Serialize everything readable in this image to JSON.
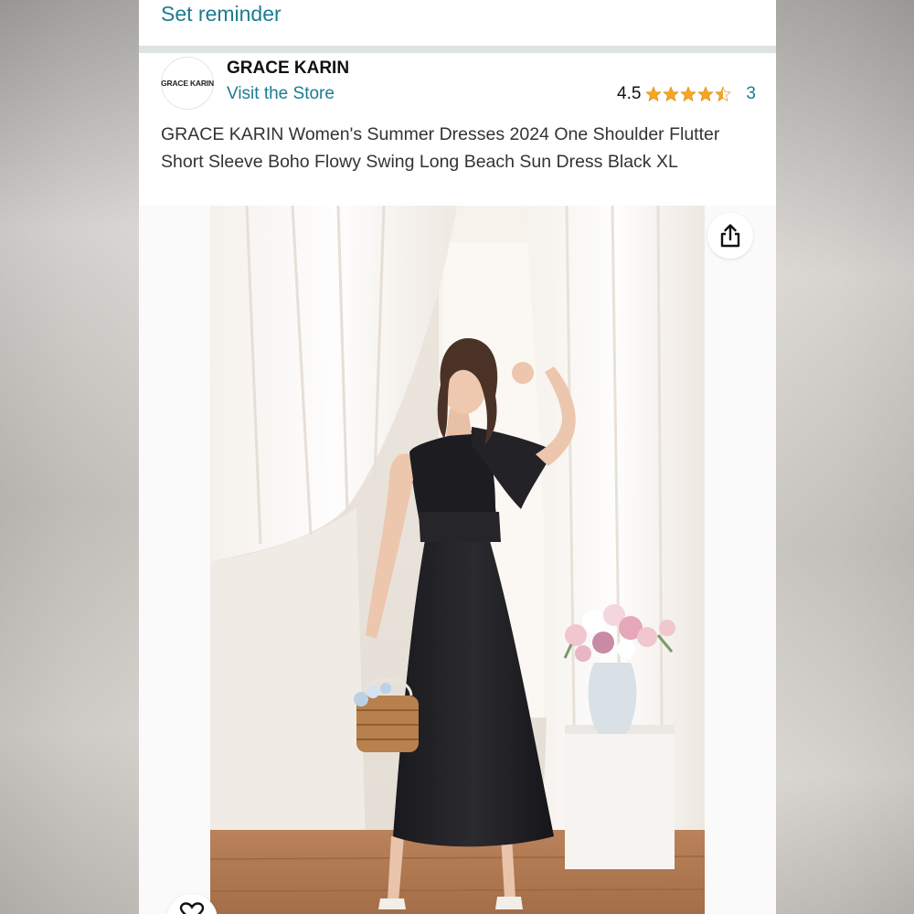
{
  "header": {
    "set_reminder": "Set reminder"
  },
  "store": {
    "logo_text": "GRACE KARIN",
    "brand_name": "GRACE KARIN",
    "visit_store": "Visit the Store",
    "rating": "4.5",
    "rating_stars": 4.5,
    "rating_count": "3",
    "star_color": "#f5a623"
  },
  "product": {
    "title": "GRACE KARIN Women's Summer Dresses 2024 One Shoulder Flutter Short Sleeve Boho Flowy Swing Long Beach Sun Dress Black XL"
  },
  "icons": {
    "share": "share-icon",
    "wishlist": "heart-icon"
  },
  "colors": {
    "link": "#1c7c91",
    "dress": "#1e1e22"
  }
}
